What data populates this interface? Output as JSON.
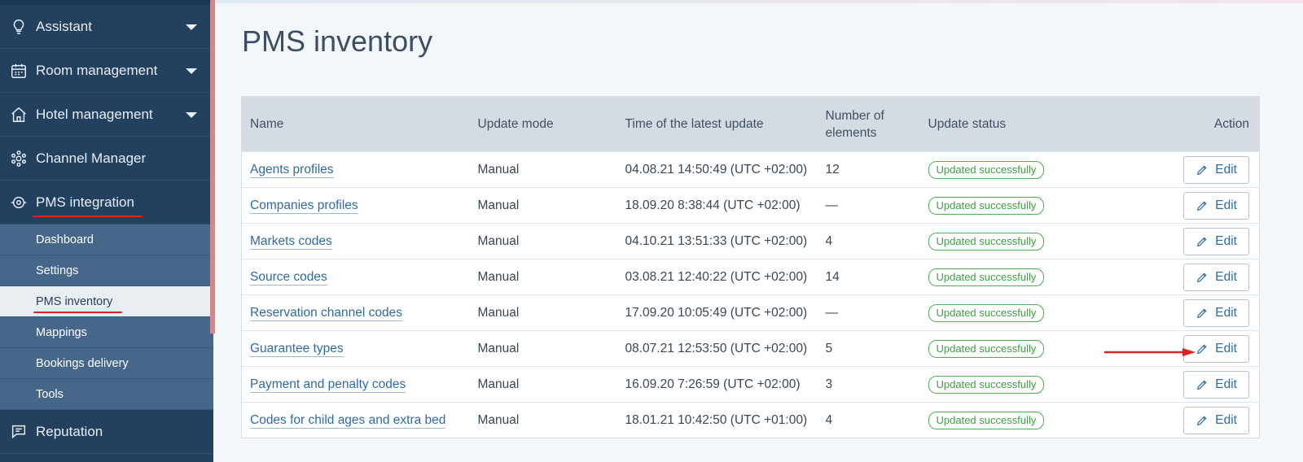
{
  "sidebar": {
    "groups": {
      "assistant": {
        "label": "Assistant",
        "icon": "lightbulb-icon"
      },
      "room": {
        "label": "Room management",
        "icon": "calendar-icon"
      },
      "hotel": {
        "label": "Hotel management",
        "icon": "house-icon"
      },
      "channel": {
        "label": "Channel Manager",
        "icon": "network-icon"
      },
      "pms": {
        "label": "PMS integration",
        "icon": "integration-eye-icon"
      },
      "reputation": {
        "label": "Reputation",
        "icon": "chat-icon"
      }
    },
    "pms_items": [
      {
        "label": "Dashboard"
      },
      {
        "label": "Settings"
      },
      {
        "label": "PMS inventory",
        "active": true
      },
      {
        "label": "Mappings"
      },
      {
        "label": "Bookings delivery"
      },
      {
        "label": "Tools"
      }
    ]
  },
  "page": {
    "title": "PMS inventory"
  },
  "table": {
    "headers": {
      "name": "Name",
      "mode": "Update mode",
      "time": "Time of the latest update",
      "count": "Number of elements",
      "status": "Update status",
      "action": "Action"
    },
    "rows": [
      {
        "name": "Agents profiles",
        "mode": "Manual",
        "time": "04.08.21 14:50:49 (UTC +02:00)",
        "count": "12",
        "status": "Updated successfully",
        "action": "Edit"
      },
      {
        "name": "Companies profiles",
        "mode": "Manual",
        "time": "18.09.20 8:38:44 (UTC +02:00)",
        "count": "—",
        "status": "Updated successfully",
        "action": "Edit"
      },
      {
        "name": "Markets codes",
        "mode": "Manual",
        "time": "04.10.21 13:51:33 (UTC +02:00)",
        "count": "4",
        "status": "Updated successfully",
        "action": "Edit"
      },
      {
        "name": "Source codes",
        "mode": "Manual",
        "time": "03.08.21 12:40:22 (UTC +02:00)",
        "count": "14",
        "status": "Updated successfully",
        "action": "Edit"
      },
      {
        "name": "Reservation channel codes",
        "mode": "Manual",
        "time": "17.09.20 10:05:49 (UTC +02:00)",
        "count": "—",
        "status": "Updated successfully",
        "action": "Edit"
      },
      {
        "name": "Guarantee types",
        "mode": "Manual",
        "time": "08.07.21 12:53:50 (UTC +02:00)",
        "count": "5",
        "status": "Updated successfully",
        "action": "Edit"
      },
      {
        "name": "Payment and penalty codes",
        "mode": "Manual",
        "time": "16.09.20 7:26:59 (UTC +02:00)",
        "count": "3",
        "status": "Updated successfully",
        "action": "Edit"
      },
      {
        "name": "Codes for child ages and extra bed",
        "mode": "Manual",
        "time": "18.01.21 10:42:50 (UTC +01:00)",
        "count": "4",
        "status": "Updated successfully",
        "action": "Edit"
      }
    ]
  },
  "colors": {
    "sidebar_bg": "#23405e",
    "submenu_bg": "#46678a",
    "link": "#2f6aa6",
    "success": "#4caf50",
    "annotation": "#e02020"
  }
}
